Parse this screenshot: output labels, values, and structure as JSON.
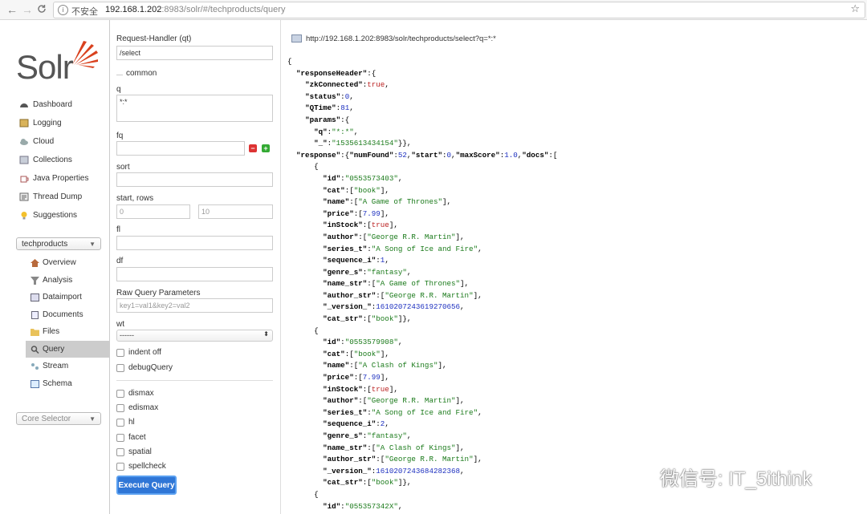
{
  "browser": {
    "back": "←",
    "forward": "→",
    "reload": "C",
    "security_label": "不安全",
    "url_host": "192.168.1.202",
    "url_rest": ":8983/solr/#/techproducts/query",
    "star": "☆"
  },
  "logo": {
    "text": "Solr"
  },
  "nav": {
    "items": [
      {
        "label": "Dashboard"
      },
      {
        "label": "Logging"
      },
      {
        "label": "Cloud"
      },
      {
        "label": "Collections"
      },
      {
        "label": "Java Properties"
      },
      {
        "label": "Thread Dump"
      },
      {
        "label": "Suggestions"
      }
    ],
    "core_dropdown": "techproducts",
    "core_items": [
      {
        "label": "Overview"
      },
      {
        "label": "Analysis"
      },
      {
        "label": "Dataimport"
      },
      {
        "label": "Documents"
      },
      {
        "label": "Files"
      },
      {
        "label": "Query"
      },
      {
        "label": "Stream"
      },
      {
        "label": "Schema"
      }
    ],
    "core_selector": "Core Selector"
  },
  "form": {
    "qt_label": "Request-Handler (qt)",
    "qt_value": "/select",
    "common_label": "common",
    "q_label": "q",
    "q_value": "*:*",
    "fq_label": "fq",
    "sort_label": "sort",
    "rows_label": "start, rows",
    "start_value": "0",
    "rows_value": "10",
    "fl_label": "fl",
    "df_label": "df",
    "raw_label": "Raw Query Parameters",
    "raw_placeholder": "key1=val1&key2=val2",
    "wt_label": "wt",
    "wt_value": "------",
    "checkboxes": [
      {
        "label": "indent off"
      },
      {
        "label": "debugQuery"
      }
    ],
    "parsers": [
      {
        "label": "dismax"
      },
      {
        "label": "edismax"
      },
      {
        "label": "hl"
      },
      {
        "label": "facet"
      },
      {
        "label": "spatial"
      },
      {
        "label": "spellcheck"
      }
    ],
    "execute_label": "Execute Query"
  },
  "results": {
    "request_url": "http://192.168.1.202:8983/solr/techproducts/select?q=*:*",
    "json_lines": [
      "{",
      "  \"responseHeader\":{",
      "    \"zkConnected\":true,",
      "    \"status\":0,",
      "    \"QTime\":81,",
      "    \"params\":{",
      "      \"q\":\"*:*\",",
      "      \"_\":\"1535613434154\"}},",
      "  \"response\":{\"numFound\":52,\"start\":0,\"maxScore\":1.0,\"docs\":[",
      "      {",
      "        \"id\":\"0553573403\",",
      "        \"cat\":[\"book\"],",
      "        \"name\":[\"A Game of Thrones\"],",
      "        \"price\":[7.99],",
      "        \"inStock\":[true],",
      "        \"author\":[\"George R.R. Martin\"],",
      "        \"series_t\":\"A Song of Ice and Fire\",",
      "        \"sequence_i\":1,",
      "        \"genre_s\":\"fantasy\",",
      "        \"name_str\":[\"A Game of Thrones\"],",
      "        \"author_str\":[\"George R.R. Martin\"],",
      "        \"_version_\":1610207243619270656,",
      "        \"cat_str\":[\"book\"]},",
      "      {",
      "        \"id\":\"0553579908\",",
      "        \"cat\":[\"book\"],",
      "        \"name\":[\"A Clash of Kings\"],",
      "        \"price\":[7.99],",
      "        \"inStock\":[true],",
      "        \"author\":[\"George R.R. Martin\"],",
      "        \"series_t\":\"A Song of Ice and Fire\",",
      "        \"sequence_i\":2,",
      "        \"genre_s\":\"fantasy\",",
      "        \"name_str\":[\"A Clash of Kings\"],",
      "        \"author_str\":[\"George R.R. Martin\"],",
      "        \"_version_\":1610207243684282368,",
      "        \"cat_str\":[\"book\"]},",
      "      {",
      "        \"id\":\"055357342X\","
    ]
  },
  "watermark": {
    "text": "微信号: IT_5ithink"
  },
  "colors": {
    "accent": "#2f76d6",
    "logo_orange": "#d9411e",
    "active_nav": "#cccccc"
  }
}
